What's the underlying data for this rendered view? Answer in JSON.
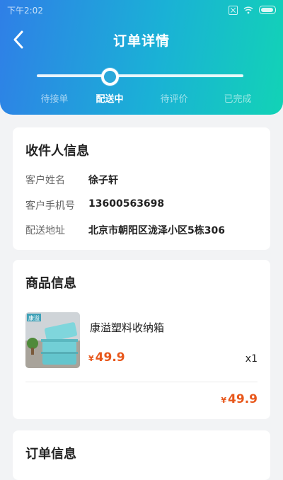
{
  "status_bar": {
    "time": "下午2:02"
  },
  "header": {
    "title": "订单详情",
    "progress": {
      "current_step_index": 1,
      "step_count": 4
    },
    "steps": [
      "待接单",
      "配送中",
      "待评价",
      "已完成"
    ]
  },
  "recipient": {
    "title": "收件人信息",
    "name_label": "客户姓名",
    "name_value": "徐子轩",
    "phone_label": "客户手机号",
    "phone_value": "13600563698",
    "address_label": "配送地址",
    "address_value": "北京市朝阳区泷泽小区5栋306"
  },
  "product": {
    "title": "商品信息",
    "name": "康溢塑料收纳箱",
    "currency": "¥",
    "price": "49.9",
    "quantity": "x1",
    "total": "49.9",
    "thumb_brand": "康溢"
  },
  "order": {
    "title": "订单信息"
  },
  "colors": {
    "header_start": "#2f7fe7",
    "header_end": "#12d3b6",
    "price": "#e8571b"
  }
}
